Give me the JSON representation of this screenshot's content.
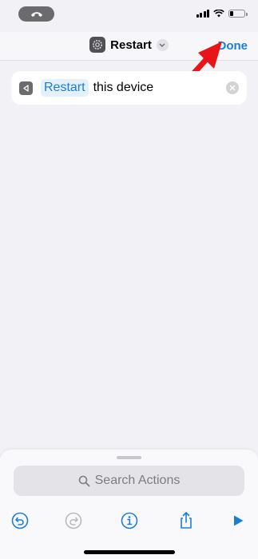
{
  "status_bar": {
    "call_icon": "phone-icon",
    "battery_level": 0.25
  },
  "nav": {
    "title": "Restart",
    "done_label": "Done",
    "app_icon": "settings-gear-icon"
  },
  "action": {
    "icon": "power-icon",
    "token": "Restart",
    "text": "this device"
  },
  "search": {
    "placeholder": "Search Actions"
  },
  "toolbar": {
    "items": [
      "undo-icon",
      "redo-icon",
      "info-icon",
      "share-icon",
      "play-icon"
    ]
  },
  "colors": {
    "accent": "#1a7fd4",
    "background": "#f2f2f6",
    "arrow": "#e8141a"
  }
}
